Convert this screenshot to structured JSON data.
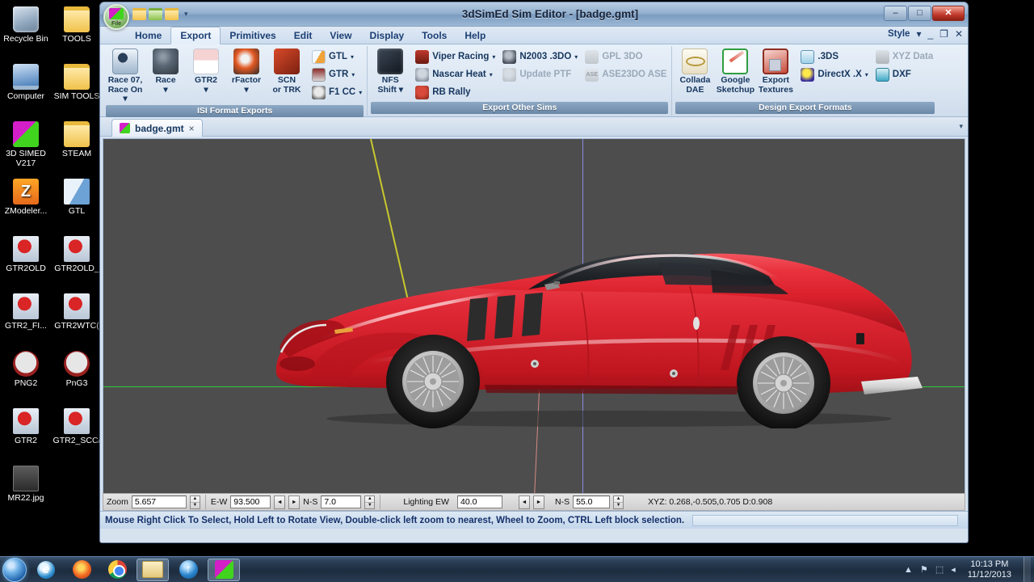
{
  "desktop": {
    "icons": [
      {
        "label": "Recycle Bin",
        "icon": "recycle-bin-icon",
        "col": 0,
        "row": 0
      },
      {
        "label": "TOOLS",
        "icon": "folder-icon",
        "col": 1,
        "row": 0
      },
      {
        "label": "Computer",
        "icon": "computer-icon",
        "col": 0,
        "row": 1
      },
      {
        "label": "SIM TOOLS",
        "icon": "folder-icon",
        "col": 1,
        "row": 1
      },
      {
        "label": "3D SIMED V217",
        "icon": "3dsimed-app-icon",
        "col": 0,
        "row": 2
      },
      {
        "label": "STEAM",
        "icon": "folder-icon",
        "col": 1,
        "row": 2
      },
      {
        "label": "ZModeler...",
        "icon": "zmodeler-app-icon",
        "col": 0,
        "row": 3
      },
      {
        "label": "GTL",
        "icon": "gtl-shortcut-icon",
        "col": 1,
        "row": 3
      },
      {
        "label": "GTR2OLD",
        "icon": "gtr2-shortcut-icon",
        "col": 0,
        "row": 4
      },
      {
        "label": "GTR2OLD_",
        "icon": "gtr2-shortcut-icon",
        "col": 1,
        "row": 4
      },
      {
        "label": "GTR2_FI...",
        "icon": "gtr2-shortcut-icon",
        "col": 0,
        "row": 5
      },
      {
        "label": "GTR2WTC(",
        "icon": "gtr2-shortcut-icon",
        "col": 1,
        "row": 5
      },
      {
        "label": "PNG2",
        "icon": "png-shortcut-icon",
        "col": 0,
        "row": 6
      },
      {
        "label": "PnG3",
        "icon": "png-shortcut-icon",
        "col": 1,
        "row": 6
      },
      {
        "label": "GTR2",
        "icon": "gtr2-shortcut-icon",
        "col": 0,
        "row": 7
      },
      {
        "label": "GTR2_SCC/",
        "icon": "gtr2-shortcut-icon",
        "col": 1,
        "row": 7
      },
      {
        "label": "MR22.jpg",
        "icon": "image-file-icon",
        "col": 0,
        "row": 8
      }
    ]
  },
  "window": {
    "title": "3dSimEd Sim Editor - [badge.gmt]",
    "file_orb_label": "File",
    "quick_access": [
      "open-folder-icon",
      "save-folder-icon",
      "folder-icon",
      "qat-dropdown-icon"
    ],
    "controls": {
      "minimize": "–",
      "maximize": "□",
      "close": "✕"
    },
    "inner_controls": {
      "minimize": "_",
      "restore": "❐",
      "close": "✕"
    }
  },
  "menu": {
    "tabs": [
      {
        "label": "Home",
        "active": false
      },
      {
        "label": "Export",
        "active": true
      },
      {
        "label": "Primitives",
        "active": false
      },
      {
        "label": "Edit",
        "active": false
      },
      {
        "label": "View",
        "active": false
      },
      {
        "label": "Display",
        "active": false
      },
      {
        "label": "Tools",
        "active": false
      },
      {
        "label": "Help",
        "active": false
      }
    ],
    "style_label": "Style"
  },
  "ribbon": {
    "groups": [
      {
        "title": "ISI Format Exports",
        "big_buttons": [
          {
            "label1": "Race 07,",
            "label2": "Race On",
            "icon": "race07-icon",
            "dropdown": true,
            "disabled": false
          },
          {
            "label1": "Race",
            "label2": "",
            "icon": "race-icon",
            "dropdown": true,
            "disabled": false
          },
          {
            "label1": "GTR2",
            "label2": "",
            "icon": "gtr2-icon",
            "dropdown": true,
            "disabled": false
          },
          {
            "label1": "rFactor",
            "label2": "",
            "icon": "rfactor-icon",
            "dropdown": true,
            "disabled": false
          },
          {
            "label1": "SCN",
            "label2": "or TRK",
            "icon": "scn-trk-icon",
            "dropdown": false,
            "disabled": false
          }
        ],
        "small_buttons": [
          {
            "label": "GTL",
            "icon": "gtl-icon",
            "dropdown": true,
            "disabled": false
          },
          {
            "label": "GTR",
            "icon": "gtr-icon",
            "dropdown": true,
            "disabled": false
          },
          {
            "label": "F1 CC",
            "icon": "f1cc-icon",
            "dropdown": true,
            "disabled": false
          }
        ]
      },
      {
        "title": "Export Other Sims",
        "big_buttons": [
          {
            "label1": "NFS",
            "label2": "Shift",
            "icon": "nfs-shift-icon",
            "dropdown": true,
            "disabled": false
          }
        ],
        "small_columns": [
          [
            {
              "label": "Viper Racing",
              "icon": "viper-racing-icon",
              "dropdown": true,
              "disabled": false
            },
            {
              "label": "Nascar Heat",
              "icon": "nascar-heat-icon",
              "dropdown": true,
              "disabled": false
            },
            {
              "label": "RB Rally",
              "icon": "rb-rally-icon",
              "dropdown": false,
              "disabled": false
            }
          ],
          [
            {
              "label": "N2003 .3DO",
              "icon": "n2003-3do-icon",
              "dropdown": true,
              "disabled": false
            },
            {
              "label": "Update PTF",
              "icon": "update-ptf-icon",
              "dropdown": false,
              "disabled": true
            }
          ],
          [
            {
              "label": "GPL 3DO",
              "icon": "gpl-3do-icon",
              "dropdown": false,
              "disabled": true
            },
            {
              "label": "ASE23DO ASE",
              "icon": "ase-icon",
              "dropdown": false,
              "disabled": true
            }
          ]
        ]
      },
      {
        "title": "Design Export Formats",
        "big_buttons": [
          {
            "label1": "Collada",
            "label2": "DAE",
            "icon": "collada-dae-icon",
            "dropdown": false,
            "disabled": false
          },
          {
            "label1": "Google",
            "label2": "Sketchup",
            "icon": "google-sketchup-icon",
            "dropdown": false,
            "disabled": false
          },
          {
            "label1": "Export",
            "label2": "Textures",
            "icon": "export-textures-icon",
            "dropdown": false,
            "disabled": false
          }
        ],
        "small_columns": [
          [
            {
              "label": ".3DS",
              "icon": "3ds-icon",
              "dropdown": false,
              "disabled": false
            },
            {
              "label": "DirectX .X",
              "icon": "directx-icon",
              "dropdown": true,
              "disabled": false
            }
          ],
          [
            {
              "label": "XYZ Data",
              "icon": "xyz-data-icon",
              "dropdown": false,
              "disabled": true
            },
            {
              "label": "DXF",
              "icon": "dxf-icon",
              "dropdown": false,
              "disabled": false
            }
          ]
        ]
      }
    ]
  },
  "document": {
    "tab_label": "badge.gmt",
    "tab_close": "×",
    "tabbar_dropdown": "▾"
  },
  "viewport": {
    "model_name": "red-sports-car-3d-model",
    "background_color": "#4d4d4d",
    "axis_colors": {
      "x": "#2cc93a",
      "y": "#c8c82e",
      "z": "#8a8ee0",
      "pivot": "#d48a86"
    },
    "body_color": "#d81f2a"
  },
  "status": {
    "zoom_label": "Zoom",
    "zoom_value": "5.657",
    "ew_label": "E-W",
    "ew_value": "93.500",
    "ns_label": "N-S",
    "ns_value": "7.0",
    "lighting_label": "Lighting EW",
    "lighting_value": "40.0",
    "lighting_ns_label": "N-S",
    "lighting_ns_value": "55.0",
    "xyz_readout": "XYZ: 0.268,-0.505,0.705  D:0.908",
    "arrow_left": "◄",
    "arrow_right": "►",
    "spin_up": "▲",
    "spin_down": "▼"
  },
  "hint": {
    "text": "Mouse Right Click To Select, Hold Left to Rotate View, Double-click left  zoom to nearest, Wheel to Zoom, CTRL Left block selection."
  },
  "taskbar": {
    "start": "start-orb-icon",
    "items": [
      {
        "icon": "internet-explorer-icon",
        "label": "e",
        "active": false
      },
      {
        "icon": "firefox-icon",
        "label": "",
        "active": false
      },
      {
        "icon": "chrome-icon",
        "label": "",
        "active": false
      },
      {
        "icon": "windows-explorer-icon",
        "label": "",
        "active": true
      },
      {
        "icon": "upload-arrow-icon",
        "label": "↑",
        "active": false
      },
      {
        "icon": "3dsimed-taskbar-icon",
        "label": "",
        "active": true
      }
    ],
    "tray": [
      "show-hidden-icons-icon",
      "flag-action-center-icon",
      "network-icon",
      "volume-icon"
    ],
    "tray_glyphs": {
      "chevron": "▲",
      "flag": "⚑",
      "network": "⬚",
      "volume": "◂"
    },
    "clock_time": "10:13 PM",
    "clock_date": "11/12/2013"
  }
}
